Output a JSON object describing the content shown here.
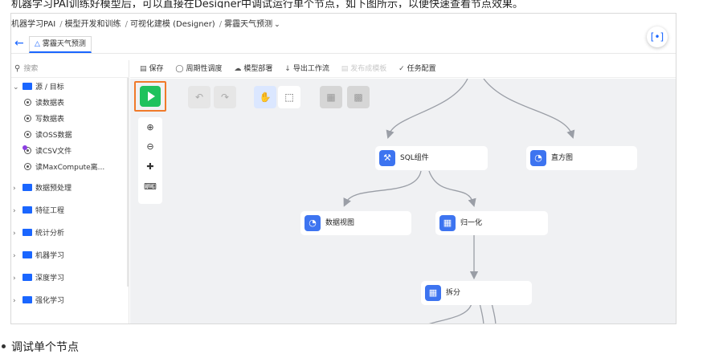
{
  "top_strip_text": "机器学习PAI训练好模型后，可以直接在Designer中调试运行单个节点，如下图所示，以便快速查看节点效果。",
  "breadcrumb": {
    "items": [
      "机器学习PAI",
      "模型开发和训练",
      "可视化建模 (Designer)",
      "雾霾天气预测"
    ],
    "separator": "/",
    "dropdown_icon": "chevron-down-icon"
  },
  "tab": {
    "label": "雾霾天气预测",
    "icon": "flask-icon"
  },
  "back_icon": "back-arrow-icon",
  "scan_icon": "scan-icon",
  "sidebar": {
    "search_placeholder": "搜索",
    "root": {
      "label": "源 / 目标",
      "expanded": true
    },
    "source_items": [
      "读数据表",
      "写数据表",
      "读OSS数据",
      "读CSV文件",
      "读MaxCompute离..."
    ],
    "folders": [
      "数据预处理",
      "特征工程",
      "统计分析",
      "机器学习",
      "深度学习",
      "强化学习"
    ]
  },
  "toolbar": {
    "items": [
      {
        "label": "保存",
        "icon": "save-icon",
        "disabled": false
      },
      {
        "label": "周期性调度",
        "icon": "clock-icon",
        "disabled": false
      },
      {
        "label": "模型部署",
        "icon": "cloud-icon",
        "disabled": false
      },
      {
        "label": "导出工作流",
        "icon": "export-icon",
        "disabled": false
      },
      {
        "label": "发布成模板",
        "icon": "template-icon",
        "disabled": true
      },
      {
        "label": "任务配置",
        "icon": "check-circle-icon",
        "disabled": false
      }
    ]
  },
  "canvas": {
    "run_button": "run-icon",
    "zoom_controls": [
      "zoom-in-icon",
      "zoom-out-icon",
      "fit-icon",
      "keyboard-icon"
    ],
    "tools": [
      "undo-icon",
      "redo-icon",
      "hand-icon",
      "select-icon",
      "layout-icon",
      "chart-icon"
    ],
    "nodes": [
      {
        "label": "SQL组件",
        "icon": "wrench-icon"
      },
      {
        "label": "直方图",
        "icon": "pie-icon"
      },
      {
        "label": "数据视图",
        "icon": "pie-icon"
      },
      {
        "label": "归一化",
        "icon": "grid-icon"
      },
      {
        "label": "拆分",
        "icon": "grid-icon"
      }
    ]
  },
  "caption": "调试单个节点",
  "colors": {
    "accent": "#1a66ff",
    "run_green": "#1fc25c",
    "highlight_orange": "#f07a2a",
    "canvas_bg": "#f0f1f3"
  }
}
